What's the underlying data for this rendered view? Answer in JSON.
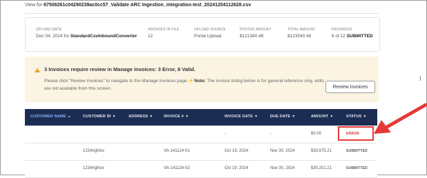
{
  "header": {
    "view_prefix": "View for ",
    "file_name": "67508261c04290239ac0cc57_Validate ARC Ingestion_integration-test_20241204112628.csv"
  },
  "summary": {
    "upload_date_label": "UPLOAD DATE",
    "upload_date_value": "Dec 04, 2024 for ",
    "upload_converter": "StandardCsvInboundConverter",
    "invoices_label": "INVOICES IN FILE",
    "invoices_value": "12",
    "source_label": "UPLOAD SOURCE",
    "source_value": "Portal Upload",
    "posted_label": "POSTED AMOUNT",
    "posted_value": "$121380.48",
    "total_label": "TOTAL AMOUNT",
    "total_value": "$123540.48",
    "progress_label": "PROGRESS",
    "progress_value": "8 of 12 ",
    "progress_status": "SUBMITTED"
  },
  "alert": {
    "title": "3 Invoices require review in Manage Invoices: 3 Error, 8 Valid.",
    "message_part1": "Please click \"Review Invoices\" to navigate to the Manage Invoices page.",
    "note_label": "Note:",
    "message_part2": " The invoice listing below is for general reference only, edits are not available from this screen.",
    "button_label": "Review Invoices",
    "warning_color": "#e8a21b",
    "background_color": "#fcf4e3"
  },
  "table": {
    "header_color": "#1b2d52",
    "columns": [
      "CUSTOMER NAME",
      "CUSTOMER ID",
      "ADDRESS",
      "INVOICE #",
      "INVOICE DATE",
      "DUE DATE",
      "AMOUNT",
      "STATUS"
    ],
    "rows": [
      {
        "customer_name": "",
        "customer_id": "",
        "address": "",
        "invoice": "",
        "invoice_date": "-",
        "due_date": "-",
        "amount": "$0.00",
        "status": "ERROR"
      },
      {
        "customer_name": "",
        "customer_id": "1234rightxx",
        "address": "",
        "invoice": "VA-141124-01",
        "invoice_date": "Oct 19, 2024",
        "due_date": "Nov 30, 2024",
        "amount": "$33,675.21",
        "status": "SUBMITTED"
      },
      {
        "customer_name": "",
        "customer_id": "1234rightxx",
        "address": "",
        "invoice": "VA-141124-02",
        "invoice_date": "Oct 19, 2024",
        "due_date": "Nov 30, 2024",
        "amount": "$30,201.21",
        "status": "SUBMITTED"
      }
    ]
  },
  "annotation": {
    "highlight_color": "#e53935",
    "cursor_glyph": "I"
  }
}
